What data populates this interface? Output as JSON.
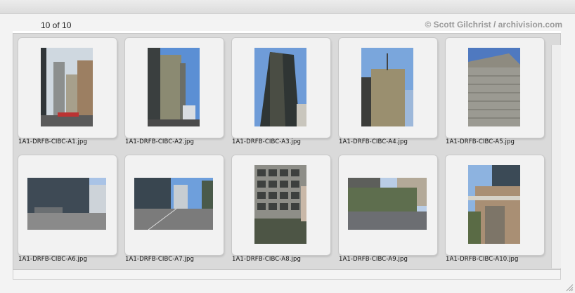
{
  "viewer": {
    "counter": "10 of 10",
    "credit": "© Scott Gilchrist / archivision.com"
  },
  "images": [
    {
      "filename": "1A1-DRFB-CIBC-A1.jpg",
      "orientation": "portrait",
      "subject": "street view of towers"
    },
    {
      "filename": "1A1-DRFB-CIBC-A2.jpg",
      "orientation": "portrait",
      "subject": "dark tower against blue sky"
    },
    {
      "filename": "1A1-DRFB-CIBC-A3.jpg",
      "orientation": "portrait",
      "subject": "tower looking up"
    },
    {
      "filename": "1A1-DRFB-CIBC-A4.jpg",
      "orientation": "portrait",
      "subject": "tower with antenna"
    },
    {
      "filename": "1A1-DRFB-CIBC-A5.jpg",
      "orientation": "portrait",
      "subject": "tower facade top"
    },
    {
      "filename": "1A1-DRFB-CIBC-A6.jpg",
      "orientation": "landscape",
      "subject": "plaza and street"
    },
    {
      "filename": "1A1-DRFB-CIBC-A7.jpg",
      "orientation": "landscape",
      "subject": "street avenue"
    },
    {
      "filename": "1A1-DRFB-CIBC-A8.jpg",
      "orientation": "portrait",
      "subject": "facade grid detail"
    },
    {
      "filename": "1A1-DRFB-CIBC-A9.jpg",
      "orientation": "landscape",
      "subject": "glass pavilion"
    },
    {
      "filename": "1A1-DRFB-CIBC-A10.jpg",
      "orientation": "portrait",
      "subject": "entrance canopy"
    }
  ],
  "colors": {
    "sky": "#5b8fd4",
    "tower_dark": "#3a3f3f",
    "tower_gold": "#9a8f6f",
    "ground": "#7d7d7d"
  }
}
